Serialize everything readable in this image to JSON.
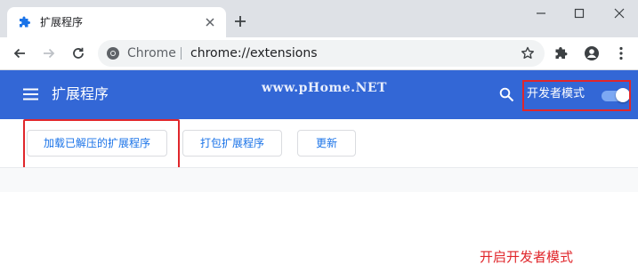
{
  "tab": {
    "title": "扩展程序"
  },
  "omnibox": {
    "site": "Chrome",
    "url": "chrome://extensions"
  },
  "header": {
    "title": "扩展程序",
    "watermark": "www.pHome.NET",
    "dev_mode_label": "开发者模式",
    "dev_mode_on": true
  },
  "actions": {
    "load_unpacked": "加载已解压的扩展程序",
    "pack": "打包扩展程序",
    "update": "更新"
  },
  "annotation": "开启开发者模式",
  "colors": {
    "header_bg": "#3367d6",
    "accent": "#1a73e8",
    "annotation_red": "#e0262b"
  }
}
